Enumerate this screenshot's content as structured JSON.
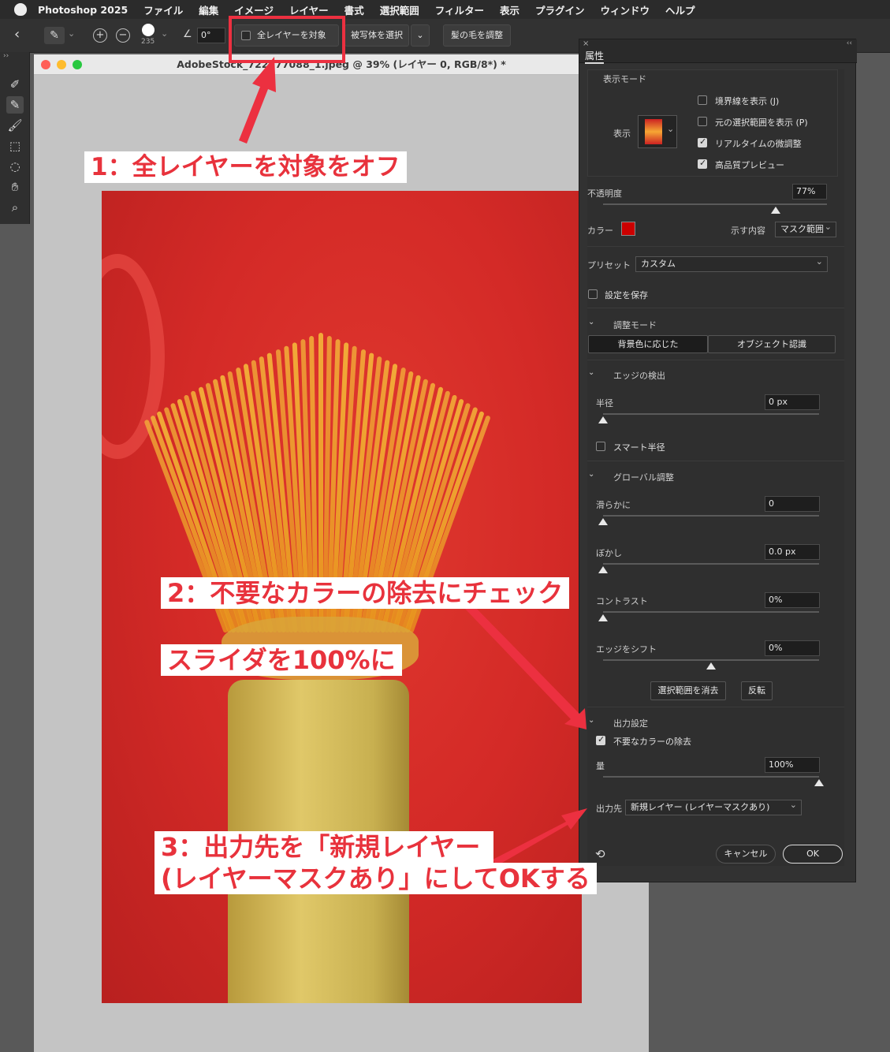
{
  "menubar": {
    "items": [
      "Photoshop 2025",
      "ファイル",
      "編集",
      "イメージ",
      "レイヤー",
      "書式",
      "選択範囲",
      "フィルター",
      "表示",
      "プラグイン",
      "ウィンドウ",
      "ヘルプ"
    ]
  },
  "options": {
    "brush_size": "235",
    "angle": "0°",
    "all_layers_label": "全レイヤーを対象",
    "select_subject_label": "被写体を選択",
    "refine_hair_label": "髪の毛を調整"
  },
  "document": {
    "title": "AdobeStock_722177088_1.jpeg @ 39% (レイヤー 0, RGB/8*) *"
  },
  "panel": {
    "title": "属性",
    "view_mode": {
      "section": "表示モード",
      "display_label": "表示",
      "show_edge": "境界線を表示 (J)",
      "show_original": "元の選択範囲を表示 (P)",
      "realtime_refine": "リアルタイムの微調整",
      "high_quality_preview": "高品質プレビュー"
    },
    "opacity_label": "不透明度",
    "opacity_value": "77%",
    "opacity_fraction": 0.77,
    "color_label": "カラー",
    "color_swatch": "#cc0000",
    "indicates_label": "示す内容",
    "indicates_value": "マスク範囲",
    "preset_label": "プリセット",
    "preset_value": "カスタム",
    "save_settings_label": "設定を保存",
    "refine_mode": {
      "section": "調整モード",
      "color_aware": "背景色に応じた",
      "object_aware": "オブジェクト認識"
    },
    "edge_detection": {
      "section": "エッジの検出",
      "radius_label": "半径",
      "radius_value": "0 px",
      "smart_radius_label": "スマート半径"
    },
    "global_refinements": {
      "section": "グローバル調整",
      "smooth_label": "滑らかに",
      "smooth_value": "0",
      "feather_label": "ぼかし",
      "feather_value": "0.0 px",
      "contrast_label": "コントラスト",
      "contrast_value": "0%",
      "shift_edge_label": "エッジをシフト",
      "shift_edge_value": "0%",
      "clear_selection": "選択範囲を消去",
      "invert": "反転"
    },
    "output": {
      "section": "出力設定",
      "decontaminate_label": "不要なカラーの除去",
      "amount_label": "量",
      "amount_value": "100%",
      "amount_fraction": 1.0,
      "output_to_label": "出力先",
      "output_to_value": "新規レイヤー (レイヤーマスクあり)"
    },
    "cancel": "キャンセル",
    "ok": "OK"
  },
  "annotations": {
    "step1": "1：全レイヤーを対象をオフ",
    "step2": "2：不要なカラーの除去にチェック",
    "step2b": "スライダを100%に",
    "step3_line1": "3：出力先を「新規レイヤー",
    "step3_line2": "(レイヤーマスクあり」にしてOKする"
  },
  "colors": {
    "annotation_red": "#e8323c",
    "photo_red": "#d42a27"
  }
}
